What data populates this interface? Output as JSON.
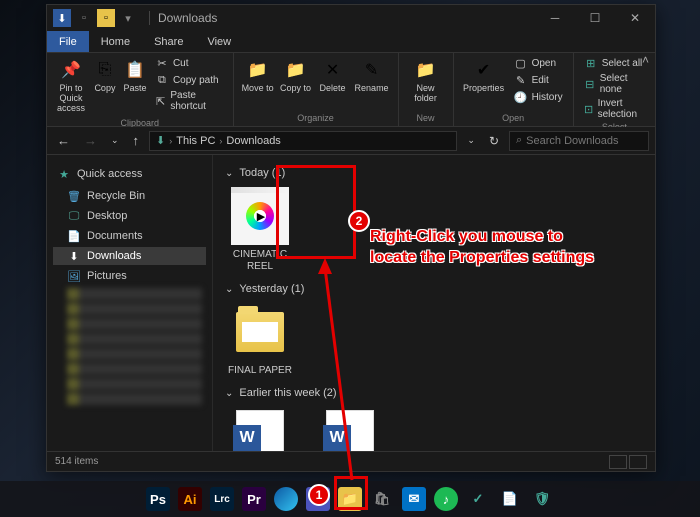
{
  "titlebar": {
    "title": "Downloads"
  },
  "tabs": {
    "file": "File",
    "home": "Home",
    "share": "Share",
    "view": "View"
  },
  "ribbon": {
    "clipboard": {
      "label": "Clipboard",
      "pin": "Pin to Quick access",
      "copy": "Copy",
      "paste": "Paste",
      "cut": "Cut",
      "copy_path": "Copy path",
      "paste_shortcut": "Paste shortcut"
    },
    "organize": {
      "label": "Organize",
      "move_to": "Move to",
      "copy_to": "Copy to",
      "delete": "Delete",
      "rename": "Rename"
    },
    "new": {
      "label": "New",
      "new_folder": "New folder"
    },
    "open": {
      "label": "Open",
      "properties": "Properties",
      "open": "Open",
      "edit": "Edit",
      "history": "History"
    },
    "select": {
      "label": "Select",
      "select_all": "Select all",
      "select_none": "Select none",
      "invert": "Invert selection"
    }
  },
  "breadcrumb": {
    "this_pc": "This PC",
    "downloads": "Downloads"
  },
  "search": {
    "placeholder": "Search Downloads"
  },
  "sidebar": {
    "quick_access": "Quick access",
    "items": [
      {
        "icon": "recycle",
        "label": "Recycle Bin"
      },
      {
        "icon": "desktop",
        "label": "Desktop"
      },
      {
        "icon": "documents",
        "label": "Documents"
      },
      {
        "icon": "downloads",
        "label": "Downloads"
      },
      {
        "icon": "pictures",
        "label": "Pictures"
      }
    ]
  },
  "sections": {
    "today": {
      "label": "Today (1)",
      "items": [
        {
          "name": "CINEMATIC REEL"
        }
      ]
    },
    "yesterday": {
      "label": "Yesterday (1)",
      "items": [
        {
          "name": "FINAL PAPER"
        }
      ]
    },
    "earlier": {
      "label": "Earlier this week (2)",
      "items": [
        {
          "name": ""
        },
        {
          "name": ""
        }
      ]
    }
  },
  "status": {
    "items": "514 items"
  },
  "annotations": {
    "badge1": "1",
    "badge2": "2",
    "text_line1": "Right-Click you mouse to",
    "text_line2": "locate the Properties settings"
  },
  "taskbar_icons": [
    "Ps",
    "Ai",
    "Lrc",
    "Pr",
    "edge",
    "teams",
    "explorer",
    "store",
    "outlook",
    "spotify",
    "check",
    "doc",
    "security"
  ]
}
